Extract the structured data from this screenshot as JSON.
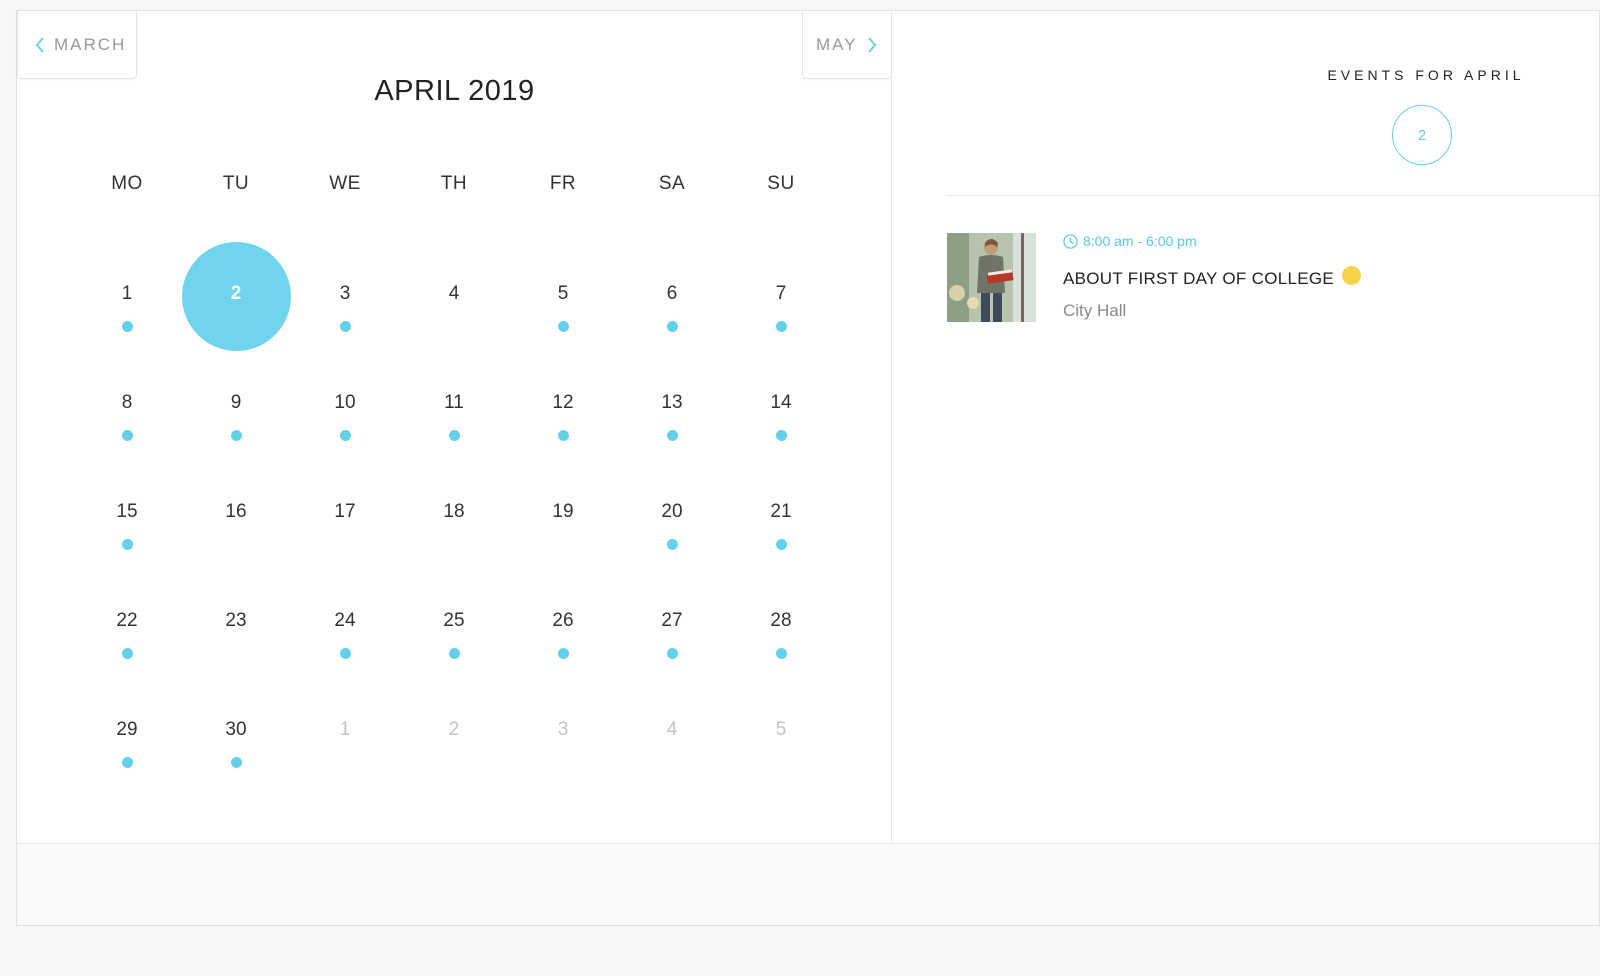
{
  "navigation": {
    "prev_label": "MARCH",
    "next_label": "MAY"
  },
  "calendar": {
    "month_title": "APRIL 2019",
    "weekdays": [
      "MO",
      "TU",
      "WE",
      "TH",
      "FR",
      "SA",
      "SU"
    ],
    "selected_day": 2,
    "weeks": [
      [
        {
          "day": "1",
          "events": true
        },
        {
          "day": "2",
          "events": false,
          "selected": true
        },
        {
          "day": "3",
          "events": true
        },
        {
          "day": "4",
          "events": false
        },
        {
          "day": "5",
          "events": true
        },
        {
          "day": "6",
          "events": true
        },
        {
          "day": "7",
          "events": true
        }
      ],
      [
        {
          "day": "8",
          "events": true
        },
        {
          "day": "9",
          "events": true
        },
        {
          "day": "10",
          "events": true
        },
        {
          "day": "11",
          "events": true
        },
        {
          "day": "12",
          "events": true
        },
        {
          "day": "13",
          "events": true
        },
        {
          "day": "14",
          "events": true
        }
      ],
      [
        {
          "day": "15",
          "events": true
        },
        {
          "day": "16",
          "events": false
        },
        {
          "day": "17",
          "events": false
        },
        {
          "day": "18",
          "events": false
        },
        {
          "day": "19",
          "events": false
        },
        {
          "day": "20",
          "events": true
        },
        {
          "day": "21",
          "events": true
        }
      ],
      [
        {
          "day": "22",
          "events": true
        },
        {
          "day": "23",
          "events": false
        },
        {
          "day": "24",
          "events": true
        },
        {
          "day": "25",
          "events": true
        },
        {
          "day": "26",
          "events": true
        },
        {
          "day": "27",
          "events": true
        },
        {
          "day": "28",
          "events": true
        }
      ],
      [
        {
          "day": "29",
          "events": true
        },
        {
          "day": "30",
          "events": true
        },
        {
          "day": "1",
          "events": false,
          "other_month": true
        },
        {
          "day": "2",
          "events": false,
          "other_month": true
        },
        {
          "day": "3",
          "events": false,
          "other_month": true
        },
        {
          "day": "4",
          "events": false,
          "other_month": true
        },
        {
          "day": "5",
          "events": false,
          "other_month": true
        }
      ]
    ]
  },
  "events_panel": {
    "title": "EVENTS FOR APRIL",
    "count": "2",
    "events": [
      {
        "time": "8:00 am - 6:00 pm",
        "name": "ABOUT FIRST DAY OF COLLEGE",
        "location": "City Hall",
        "thumbnail_icon": "student-reading-photo"
      }
    ]
  },
  "colors": {
    "accent": "#64d0ea",
    "selected_day_bg": "#6fd4ec",
    "event_marker": "#f5d44a",
    "text_dark": "#222222",
    "text_muted": "#8a8a8a"
  }
}
